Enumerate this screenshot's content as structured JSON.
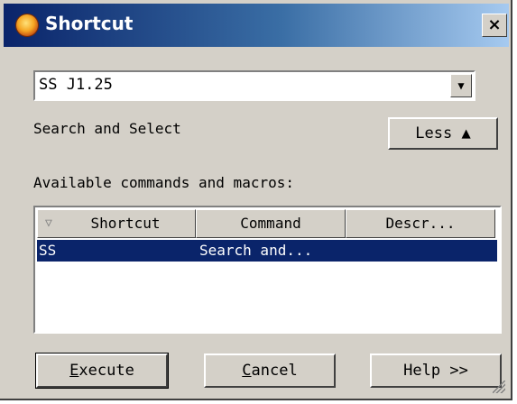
{
  "window": {
    "title": "Shortcut",
    "close_glyph": "×"
  },
  "combo": {
    "value": "SS J1.25",
    "arrow_glyph": "▼"
  },
  "search_label": "Search and Select",
  "less_button": {
    "label": "Less ▲"
  },
  "available_label": "Available commands and macros:",
  "list": {
    "sort_glyph": "▽",
    "columns": [
      "Shortcut",
      "Command",
      "Descr..."
    ],
    "rows": [
      {
        "shortcut": "SS",
        "command": "Search and...",
        "description": ""
      }
    ],
    "selected_row": 0
  },
  "buttons": {
    "execute": {
      "label": "Execute",
      "mnemonic": "E"
    },
    "cancel": {
      "label": "Cancel",
      "mnemonic": "C"
    },
    "help": {
      "label": "Help >>"
    }
  },
  "colors": {
    "title_bar": "#0a246a",
    "selection": "#0a246a",
    "face": "#d4d0c8"
  }
}
